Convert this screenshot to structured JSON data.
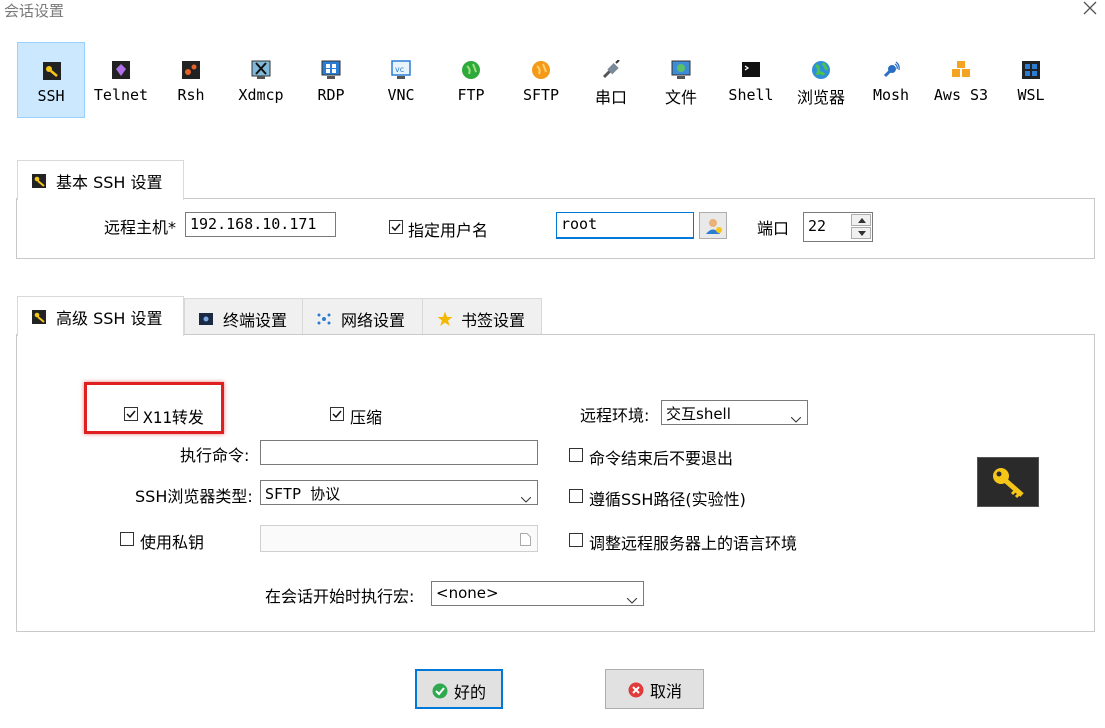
{
  "window": {
    "title": "会话设置"
  },
  "session_types": [
    {
      "label": "SSH",
      "icon": "key-icon",
      "selected": true
    },
    {
      "label": "Telnet",
      "icon": "telnet-icon"
    },
    {
      "label": "Rsh",
      "icon": "rsh-icon"
    },
    {
      "label": "Xdmcp",
      "icon": "xdmcp-icon"
    },
    {
      "label": "RDP",
      "icon": "rdp-icon"
    },
    {
      "label": "VNC",
      "icon": "vnc-icon"
    },
    {
      "label": "FTP",
      "icon": "ftp-icon"
    },
    {
      "label": "SFTP",
      "icon": "sftp-icon"
    },
    {
      "label": "串口",
      "icon": "serial-icon"
    },
    {
      "label": "文件",
      "icon": "file-icon"
    },
    {
      "label": "Shell",
      "icon": "shell-icon"
    },
    {
      "label": "浏览器",
      "icon": "browser-icon"
    },
    {
      "label": "Mosh",
      "icon": "mosh-icon"
    },
    {
      "label": "Aws S3",
      "icon": "aws-s3-icon"
    },
    {
      "label": "WSL",
      "icon": "wsl-icon"
    }
  ],
  "basic": {
    "tab_label": "基本 SSH 设置",
    "remote_host_label": "远程主机*",
    "remote_host_value": "192.168.10.171",
    "specify_user_label": "指定用户名",
    "specify_user_checked": true,
    "username_value": "root",
    "port_label": "端口",
    "port_value": "22"
  },
  "advanced_tabs": [
    {
      "label": "高级 SSH 设置",
      "icon": "key-icon",
      "active": true
    },
    {
      "label": "终端设置",
      "icon": "terminal-icon"
    },
    {
      "label": "网络设置",
      "icon": "network-icon"
    },
    {
      "label": "书签设置",
      "icon": "star-icon"
    }
  ],
  "advanced": {
    "x11_label": "X11转发",
    "x11_checked": true,
    "compress_label": "压缩",
    "compress_checked": true,
    "remote_env_label": "远程环境:",
    "remote_env_value": "交互shell",
    "exec_cmd_label": "执行命令:",
    "exec_cmd_value": "",
    "no_exit_label": "命令结束后不要退出",
    "no_exit_checked": false,
    "ssh_browser_label": "SSH浏览器类型:",
    "ssh_browser_value": "SFTP 协议",
    "follow_path_label": "遵循SSH路径(实验性)",
    "follow_path_checked": false,
    "private_key_label": "使用私钥",
    "private_key_checked": false,
    "adjust_locale_label": "调整远程服务器上的语言环境",
    "adjust_locale_checked": false,
    "macro_label": "在会话开始时执行宏:",
    "macro_value": "<none>"
  },
  "buttons": {
    "ok_label": "好的",
    "cancel_label": "取消"
  },
  "colors": {
    "selection_bg": "#cce8ff",
    "accent": "#0078d7",
    "highlight": "#e02020",
    "ok_green": "#2fa84f",
    "cancel_red": "#e03a3a"
  }
}
